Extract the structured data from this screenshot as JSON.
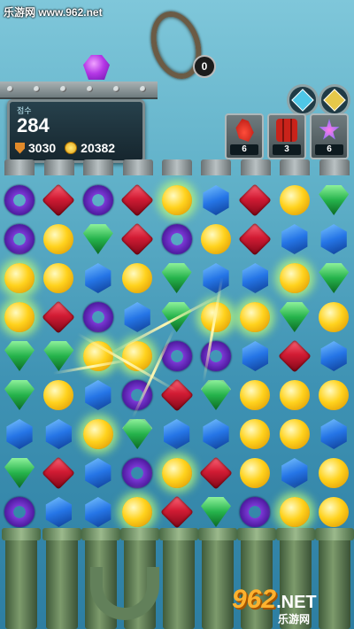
{
  "watermark": "乐游网 www.962.net",
  "header": {
    "ring_counter": "0",
    "score_label": "점수",
    "score": "284",
    "shield_value": "3030",
    "coin_value": "20382"
  },
  "boosters": [
    {
      "name": "chili",
      "count": "6"
    },
    {
      "name": "dynamite",
      "count": "3"
    },
    {
      "name": "starburst",
      "count": "6"
    }
  ],
  "board": {
    "rows": [
      [
        "donut",
        "ruby",
        "donut",
        "ruby",
        "sun",
        "sapphire",
        "ruby",
        "sun",
        "emerald"
      ],
      [
        "donut",
        "sun",
        "emerald",
        "ruby",
        "donut",
        "sun",
        "ruby",
        "sapphire",
        "sapphire"
      ],
      [
        "sun",
        "sun",
        "sapphire",
        "sun",
        "emerald",
        "sapphire",
        "sapphire",
        "sun",
        "emerald"
      ],
      [
        "sun",
        "ruby",
        "donut",
        "sapphire",
        "emerald",
        "sun",
        "sun",
        "emerald",
        "sun"
      ],
      [
        "emerald",
        "emerald",
        "sun",
        "sun",
        "donut",
        "donut",
        "sapphire",
        "ruby",
        "sapphire"
      ],
      [
        "emerald",
        "sun",
        "sapphire",
        "donut",
        "ruby",
        "emerald",
        "sun",
        "sun",
        "sun"
      ],
      [
        "sapphire",
        "sapphire",
        "sun",
        "emerald",
        "sapphire",
        "sapphire",
        "sun",
        "sun",
        "sapphire"
      ],
      [
        "emerald",
        "ruby",
        "sapphire",
        "donut",
        "sun",
        "ruby",
        "sun",
        "sapphire",
        "sun"
      ],
      [
        "donut",
        "sapphire",
        "sapphire",
        "sun",
        "ruby",
        "emerald",
        "donut",
        "sun",
        "sun"
      ]
    ],
    "glowing": [
      [
        2,
        0
      ],
      [
        2,
        2
      ],
      [
        3,
        0
      ],
      [
        4,
        2
      ],
      [
        4,
        3
      ],
      [
        5,
        4
      ],
      [
        5,
        5
      ],
      [
        6,
        2
      ],
      [
        6,
        3
      ],
      [
        7,
        4
      ],
      [
        8,
        3
      ],
      [
        8,
        6
      ],
      [
        8,
        7
      ],
      [
        0,
        4
      ],
      [
        2,
        7
      ],
      [
        3,
        5
      ],
      [
        3,
        6
      ],
      [
        4,
        5
      ]
    ]
  },
  "site_logo": {
    "number": "962",
    "suffix": ".NET",
    "subtitle": "乐游网"
  },
  "colors": {
    "accent": "#ffd21d",
    "panel": "#16262e"
  }
}
